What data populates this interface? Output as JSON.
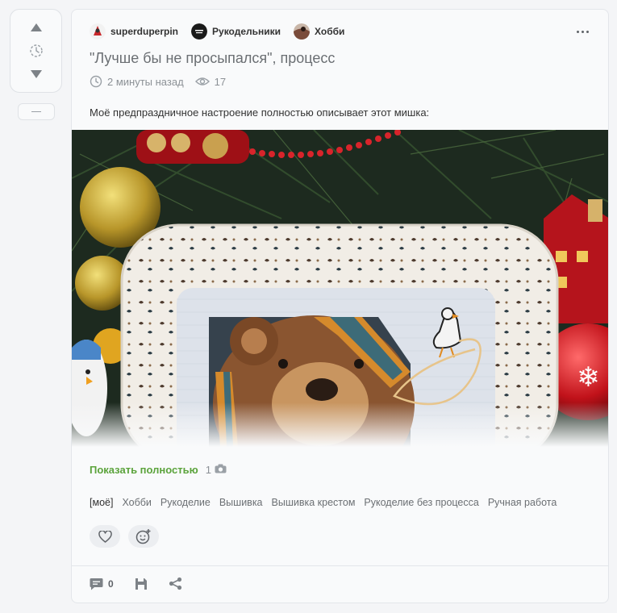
{
  "rating": {
    "upvote_icon": "arrow-up-icon",
    "pending_icon": "clock-pending-icon",
    "downvote_icon": "arrow-down-icon"
  },
  "story": {
    "communities": [
      {
        "name": "superduperpin",
        "avatar_color": "#c8262a"
      },
      {
        "name": "Рукодельники",
        "avatar_color": "#1a1a1a"
      },
      {
        "name": "Хобби",
        "avatar_color": "#7a4b3a"
      }
    ],
    "title": "\"Лучше бы не просыпался\", процесс",
    "time": "2 минуты назад",
    "views": "17",
    "text": "Моё предпраздничное настроение полностью описывает этот мишка:",
    "show_more": "Показать полностью",
    "photo_count": "1",
    "tags": [
      "[моё]",
      "Хобби",
      "Рукоделие",
      "Вышивка",
      "Вышивка крестом",
      "Рукоделие без процесса",
      "Ручная работа"
    ],
    "comments_count": "0"
  },
  "colors": {
    "accent_green": "#5ba33b",
    "card_bg": "#f9fafb",
    "page_bg": "#f4f5f7"
  }
}
